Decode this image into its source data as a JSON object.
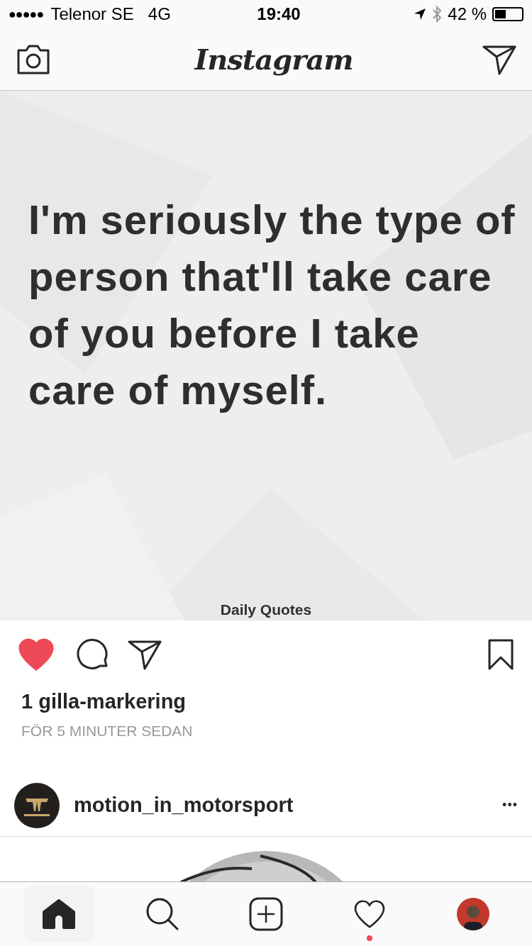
{
  "status_bar": {
    "signal_dots": "●●●●●",
    "carrier": "Telenor SE",
    "network": "4G",
    "time": "19:40",
    "battery_percent": "42 %"
  },
  "header": {
    "logo": "Instagram"
  },
  "posts": [
    {
      "kind": "quote",
      "image_text": "I'm seriously the type of person that'll take care of you before I take care of myself.",
      "image_footer": "Daily Quotes",
      "liked": true,
      "likes": "1 gilla-markering",
      "time": "FÖR 5 MINUTER SEDAN"
    },
    {
      "username": "motion_in_motorsport",
      "more": "•••"
    }
  ],
  "tab_bar": [
    {
      "kind": "home",
      "selected": true,
      "badge": false
    },
    {
      "kind": "search",
      "selected": false,
      "badge": false
    },
    {
      "kind": "add",
      "selected": false,
      "badge": false
    },
    {
      "kind": "activity",
      "selected": false,
      "badge": true
    },
    {
      "kind": "profile",
      "selected": false,
      "badge": false
    }
  ]
}
